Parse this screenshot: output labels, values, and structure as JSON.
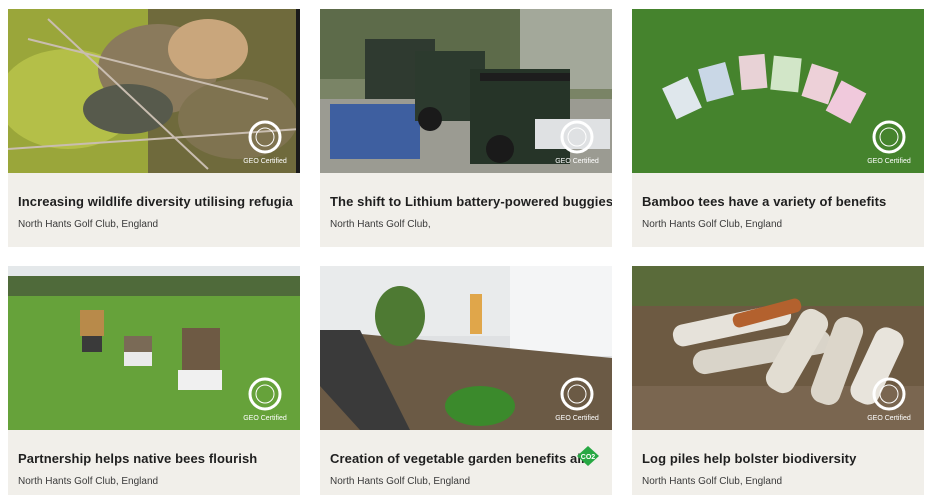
{
  "badge": {
    "label": "GEO Certified"
  },
  "co2_icon": {
    "label": "CO2"
  },
  "cards": [
    {
      "title": "Increasing wildlife diversity utilising refugia",
      "location": "North Hants Golf Club, England"
    },
    {
      "title": "The shift to Lithium battery-powered buggies",
      "location": "North Hants Golf Club,"
    },
    {
      "title": "Bamboo tees have a variety of benefits",
      "location": "North Hants Golf Club, England"
    },
    {
      "title": "Partnership helps native bees flourish",
      "location": "North Hants Golf Club, England"
    },
    {
      "title": "Creation of vegetable garden benefits all",
      "location": "North Hants Golf Club, England"
    },
    {
      "title": "Log piles help bolster biodiversity",
      "location": "North Hants Golf Club, England"
    }
  ]
}
